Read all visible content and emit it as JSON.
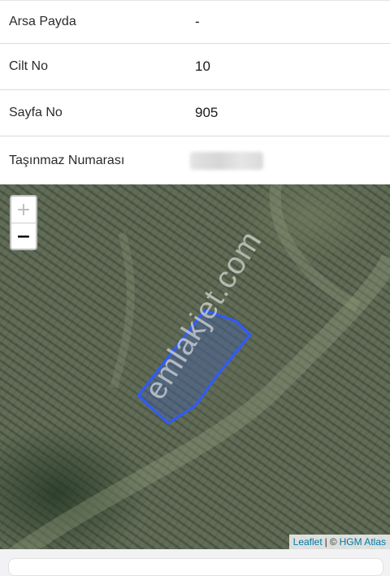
{
  "property_info": {
    "rows": [
      {
        "label": "Arsa Payda",
        "value": "-"
      },
      {
        "label": "Cilt No",
        "value": "10"
      },
      {
        "label": "Sayfa No",
        "value": "905"
      },
      {
        "label": "Taşınmaz Numarası",
        "value": ""
      }
    ]
  },
  "map": {
    "zoom_in_label": "+",
    "zoom_out_label": "−",
    "watermark": "emlakjet.com",
    "attribution": {
      "leaflet": "Leaflet",
      "separator": "|",
      "copyright": "©",
      "provider": "HGM Atlas"
    },
    "parcel_color": "#2f5bff"
  }
}
